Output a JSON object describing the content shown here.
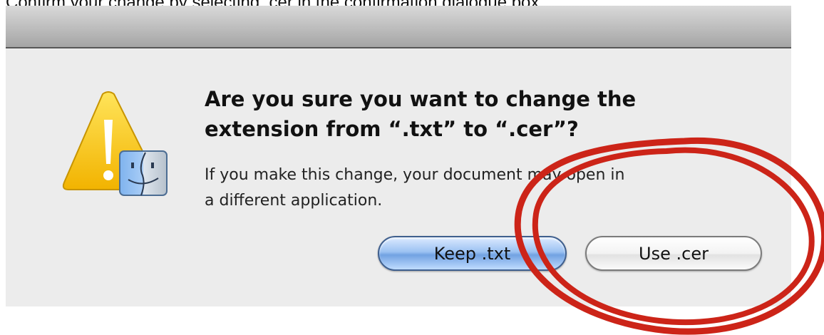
{
  "caption": "Confirm your change by selecting .cer in the confirmation dialogue box.",
  "dialog": {
    "title_lines": [
      "Are you sure you want to change the",
      "extension from “.txt” to “.cer”?"
    ],
    "message_lines": [
      "If you make this change, your document may open in",
      "a different application."
    ],
    "buttons": {
      "keep_label": "Keep .txt",
      "use_label": "Use .cer"
    },
    "icons": {
      "alert": "warning-triangle-icon",
      "app": "finder-icon"
    }
  },
  "annotation": {
    "highlight_color": "#cc2418",
    "highlight_target": "use-cer-button"
  }
}
